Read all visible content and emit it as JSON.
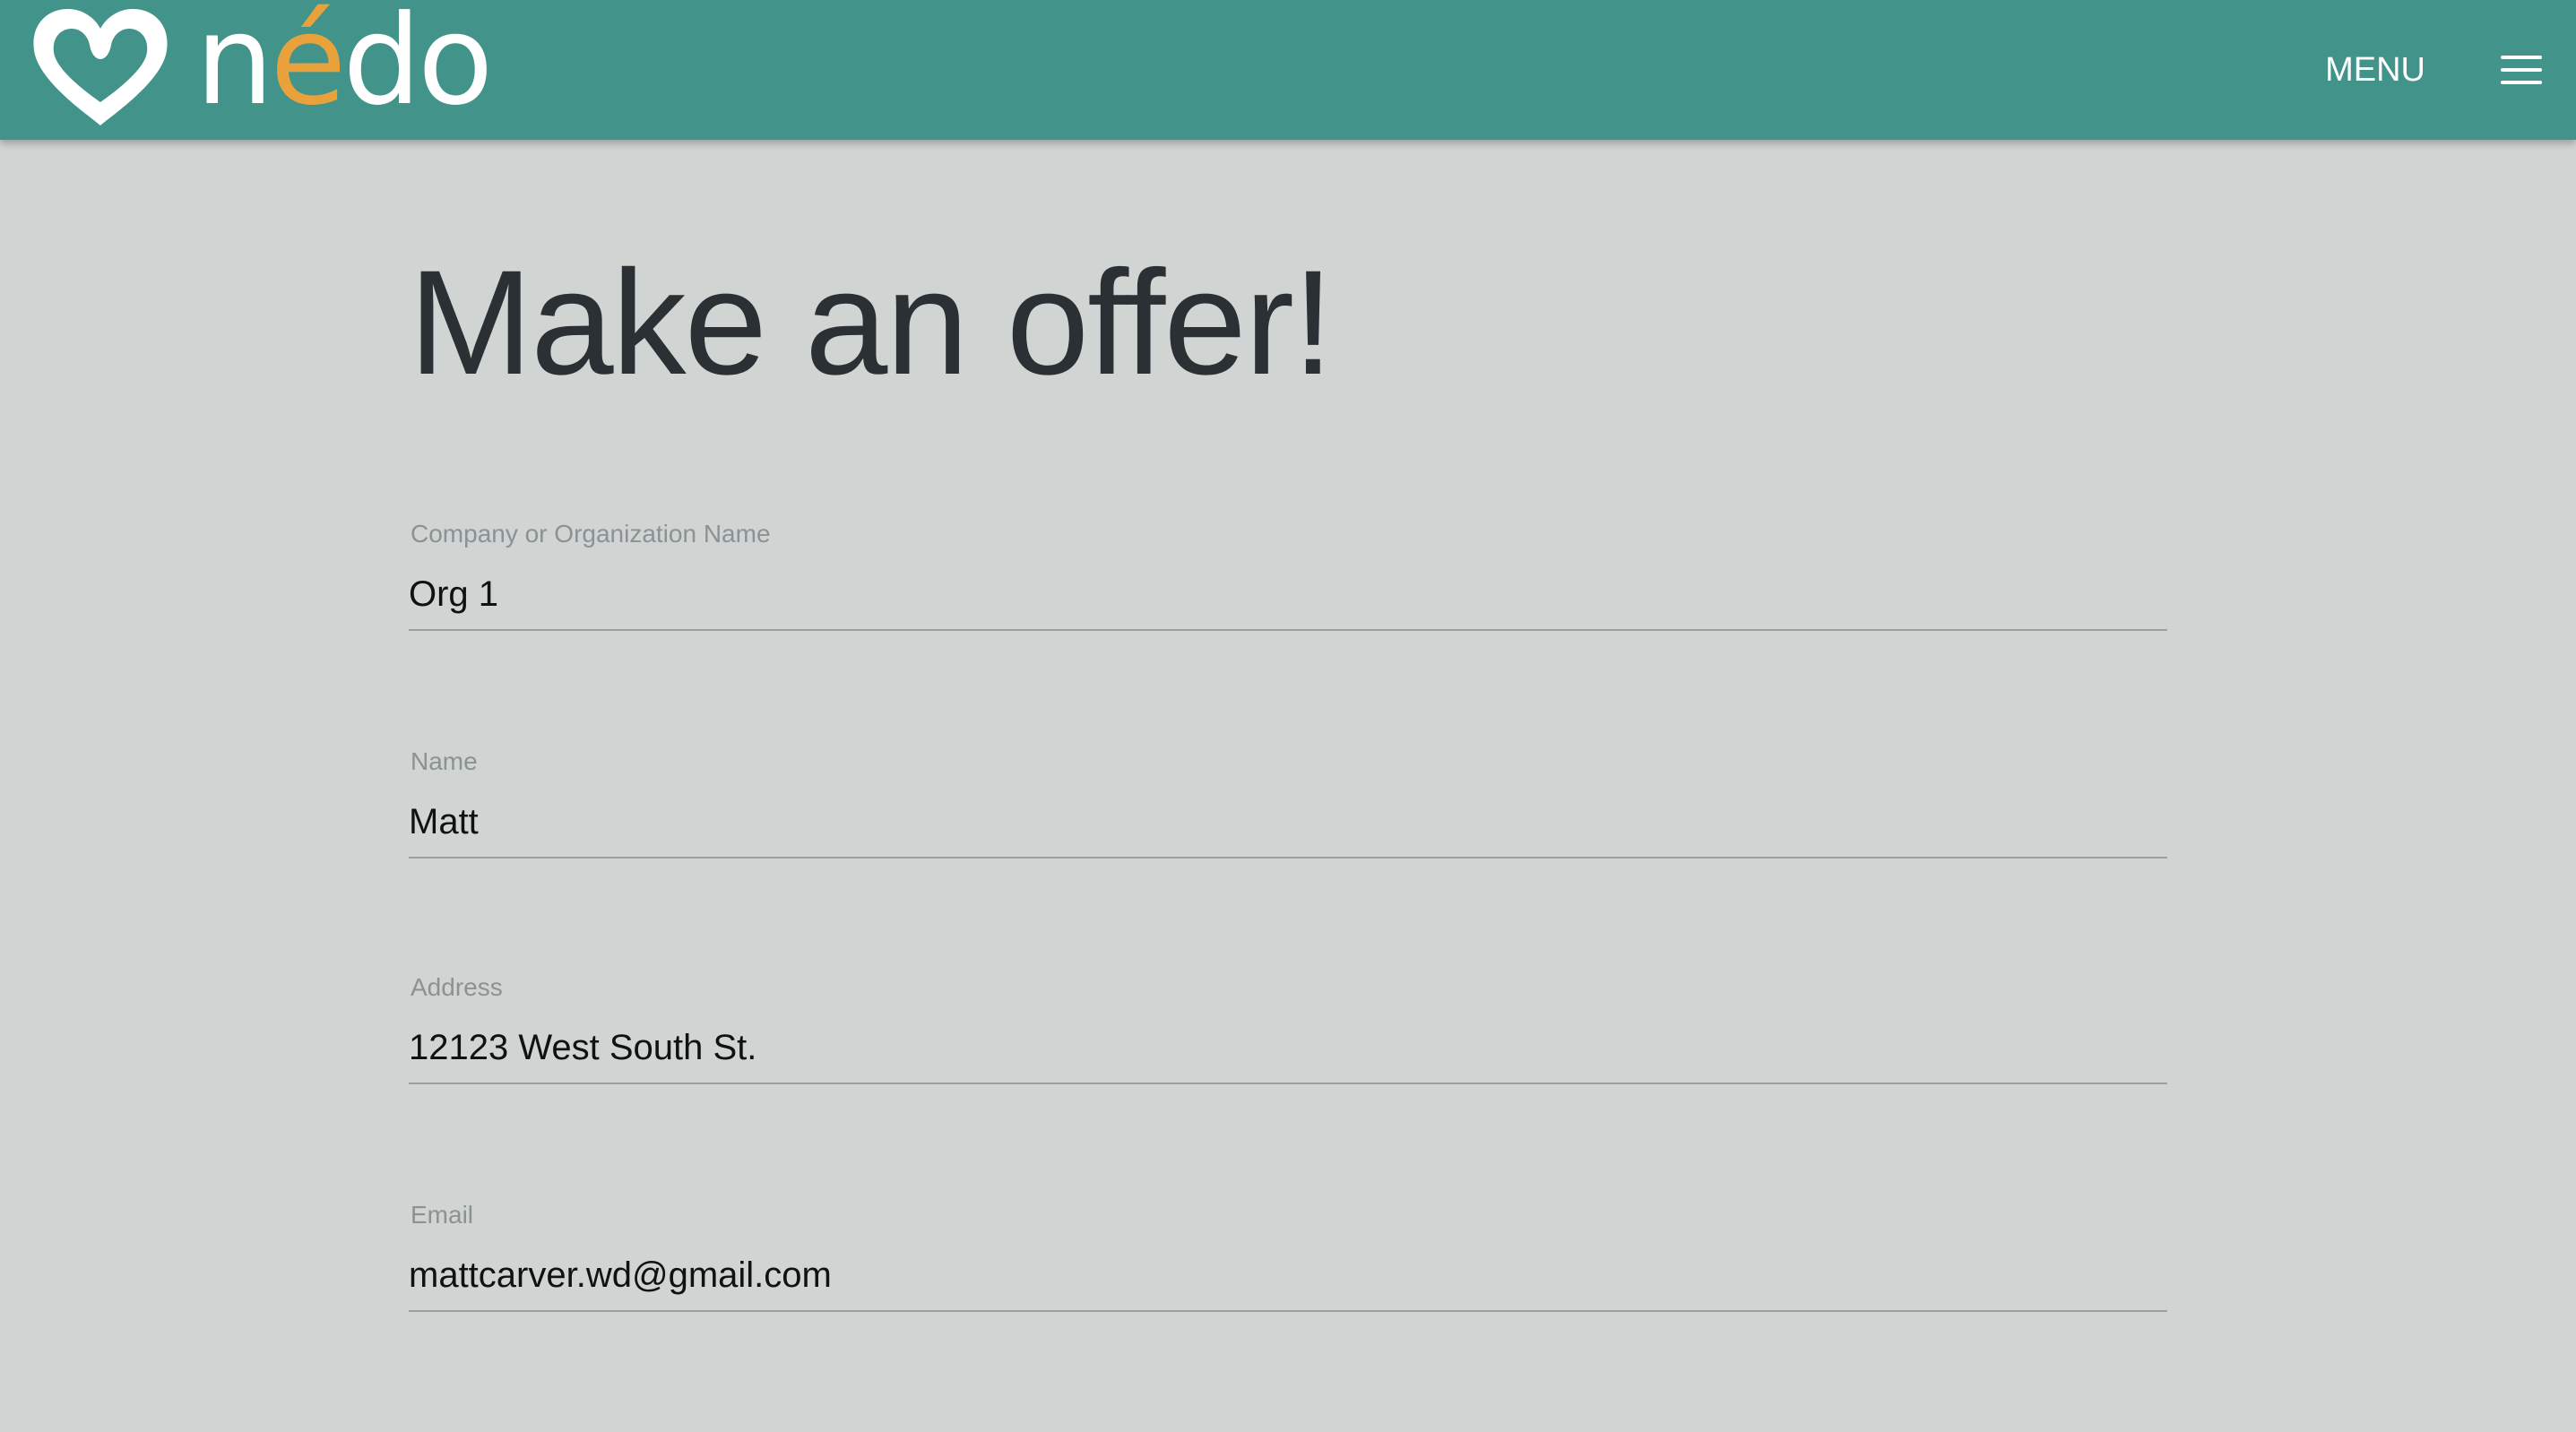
{
  "header": {
    "brand": {
      "icon": "heart-icon",
      "word_start": "n",
      "word_accent": "é",
      "word_end": "do"
    },
    "menu_label": "MENU",
    "menu_icon": "hamburger-icon"
  },
  "colors": {
    "topbar": "#42948a",
    "accent": "#e9a23b",
    "background": "#d0d4d3",
    "title": "#2a3033"
  },
  "page": {
    "title": "Make an offer!"
  },
  "form": {
    "fields": [
      {
        "label": "Company or Organization Name",
        "value": "Org 1"
      },
      {
        "label": "Name",
        "value": "Matt"
      },
      {
        "label": "Address",
        "value": "12123 West South St."
      },
      {
        "label": "Email",
        "value": "mattcarver.wd@gmail.com"
      }
    ]
  }
}
